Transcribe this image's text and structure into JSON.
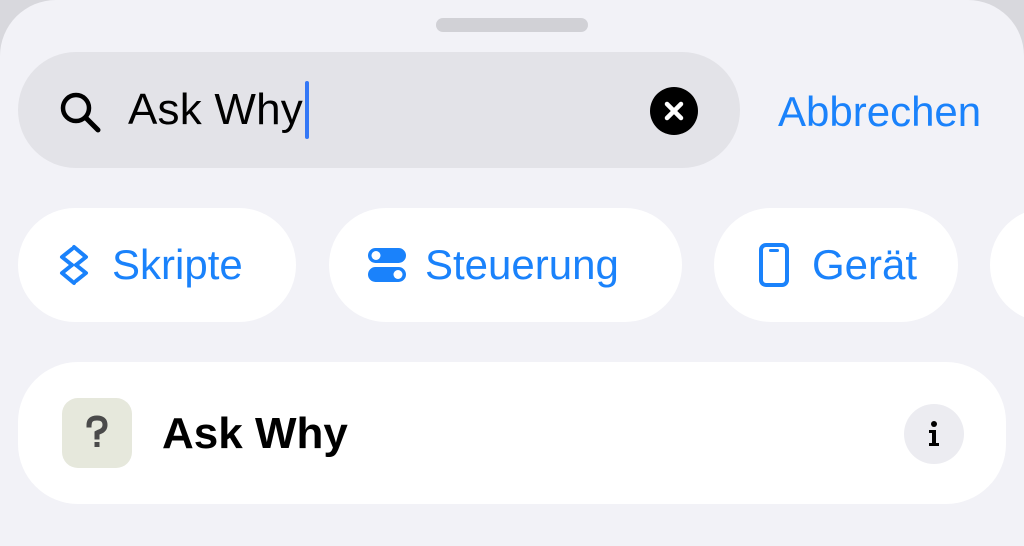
{
  "search": {
    "query": "Ask Why",
    "cancel_label": "Abbrechen"
  },
  "categories": [
    {
      "label": "Skripte",
      "icon": "scripts-icon"
    },
    {
      "label": "Steuerung",
      "icon": "toggle-controls-icon"
    },
    {
      "label": "Gerät",
      "icon": "phone-device-icon"
    }
  ],
  "results": [
    {
      "title": "Ask Why",
      "icon": "question-mark-app-icon"
    }
  ],
  "colors": {
    "accent": "#1a82fb",
    "sheet_background": "#f2f2f7",
    "search_field": "#e3e3e8",
    "caret": "#3478f6"
  }
}
